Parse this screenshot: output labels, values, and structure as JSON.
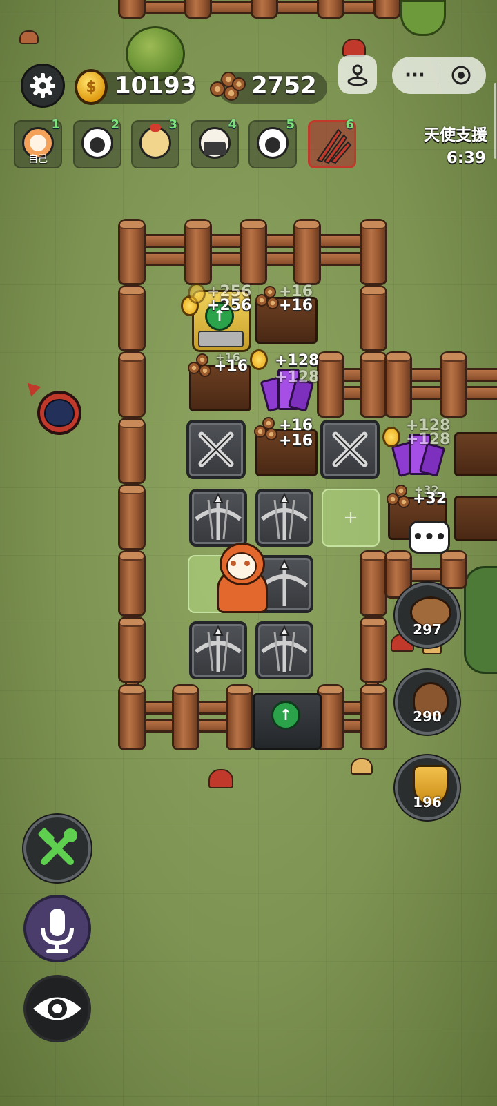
{
  "hud": {
    "coins": "10193",
    "wood": "2752",
    "settings_icon": "gear-icon",
    "coin_icon": "coin-icon",
    "wood_icon": "wood-logs-icon"
  },
  "players": [
    {
      "num": "1",
      "tag": "自己",
      "avatar": "lion-sheep-avatar",
      "color": "#f4a15a"
    },
    {
      "num": "2",
      "tag": "",
      "avatar": "black-sheep-avatar",
      "color": "#2b2b2b"
    },
    {
      "num": "3",
      "tag": "",
      "avatar": "chicken-sheep-avatar",
      "color": "#f1d58c"
    },
    {
      "num": "4",
      "tag": "",
      "avatar": "ninja-sheep-avatar",
      "color": "#3a3a3a"
    },
    {
      "num": "5",
      "tag": "",
      "avatar": "black-sheep-avatar",
      "color": "#2b2b2b"
    },
    {
      "num": "6",
      "tag": "",
      "avatar": "wolf-claw-avatar",
      "color": "#c0392b"
    }
  ],
  "angel_support": {
    "label": "天使支援",
    "timer": "6:39"
  },
  "gains": {
    "top_left_a": "+256",
    "top_left_b": "+256",
    "top_mid_a": "+16",
    "top_mid_b": "+16",
    "row2_left_a": "+16",
    "row2_left_b": "+16",
    "row2_mid_a": "+128",
    "row2_mid_b": "+128",
    "row3_mid_a": "+16",
    "row3_mid_b": "+16",
    "row3_right_a": "+128",
    "row3_right_b": "+128",
    "row4_right_a": "+32",
    "row4_right_b": "+32"
  },
  "side_items": [
    {
      "name": "piggy-bank-icon",
      "value": "297"
    },
    {
      "name": "poop-icon",
      "value": "290"
    },
    {
      "name": "shield-icon",
      "value": "196"
    }
  ],
  "bottom_buttons": [
    "build-tools-icon",
    "microphone-icon",
    "eye-icon"
  ],
  "colors": {
    "gain_text": "#ffffff",
    "player_num": "#7de07a",
    "enemy_marker": "#c0392b"
  }
}
